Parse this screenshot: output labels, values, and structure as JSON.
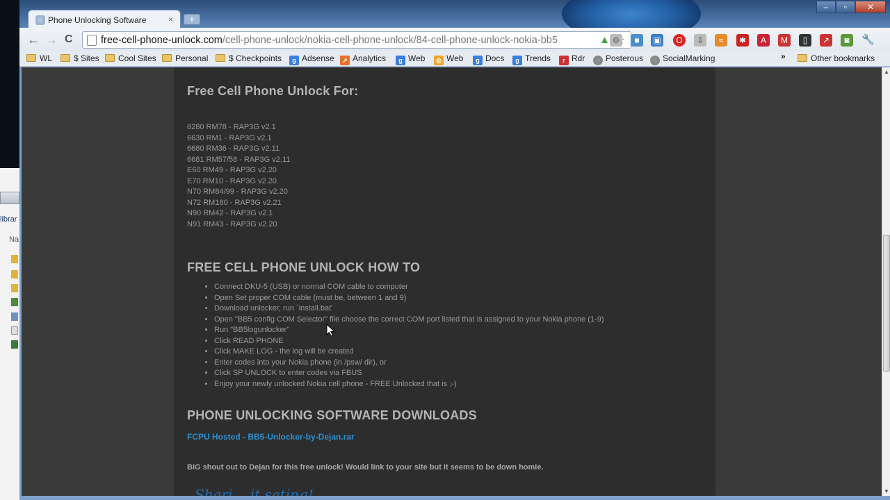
{
  "window": {
    "tab_title": "Phone Unlocking Software",
    "tab_close": "×",
    "new_tab": "+",
    "controls": {
      "minimize": "–",
      "maximize": "▫",
      "close": "✕"
    }
  },
  "desktop": {
    "library_label": "librar",
    "name_label": "Na"
  },
  "toolbar": {
    "back": "←",
    "forward": "→",
    "reload": "C",
    "url_domain": "free-cell-phone-unlock.com",
    "url_path": "/cell-phone-unlock/nokia-cell-phone-unlock/84-cell-phone-unlock-nokia-bb5",
    "wrench": "🔧"
  },
  "bookmarks": {
    "items": [
      "WL",
      "$ Sites",
      "Cool Sites",
      "Personal",
      "$ Checkpoints",
      "Adsense",
      "Analytics",
      "Web",
      "Web",
      "Docs",
      "Trends",
      "Rdr",
      "Posterous",
      "SocialMarking"
    ],
    "overflow": "»",
    "other": "Other bookmarks"
  },
  "page": {
    "heading_unlock_for": "Free Cell Phone Unlock For:",
    "models": [
      "6280 RM78 - RAP3G v2.1",
      "6630 RM1 - RAP3G v2.1",
      "6680 RM36 - RAP3G v2.11",
      "6681 RM57/58 - RAP3G v2.11",
      "E60 RM49 - RAP3G v2.20",
      "E70 RM10 - RAP3G v2.20",
      "N70 RM84/99 - RAP3G v2.20",
      "N72 RM180 - RAP3G v2.21",
      "N90 RM42 - RAP3G v2.1",
      "N91 RM43 - RAP3G v2.20"
    ],
    "heading_howto": "FREE CELL PHONE UNLOCK HOW TO",
    "steps": [
      "Connect DKU-5 (USB) or normal COM cable to computer",
      "Open Set proper COM cable (must be, between 1 and 9)",
      "Download unlocker, run `install.bat'",
      "Open \"BB5 config COM Selector\" file choose the correct COM port listed that is assigned to your Nokia phone (1-9)",
      "Run \"BB5logunlocker\"",
      "Click READ PHONE",
      "Click MAKE LOG - the log will be created",
      "Enter codes into your Nokia phone (in /psw/ dir), or",
      "Click SP UNLOCK to enter codes via FBUS",
      "Enjoy your newly unlocked Nokia cell phone - FREE Unlocked that is ;-)"
    ],
    "heading_downloads": "PHONE UNLOCKING SOFTWARE DOWNLOADS",
    "download_link": "FCPU Hosted - BB5-Unlocker-by-Dejan.rar",
    "shout": "BIG shout out to Dejan for this free unlock! Would link to your site but it seems to be down homie.",
    "signature": "Shari... it sating!"
  },
  "colors": {
    "link": "#2c8fd1",
    "content_bg": "#2d2d2d",
    "page_bg": "#3a3a3a"
  }
}
